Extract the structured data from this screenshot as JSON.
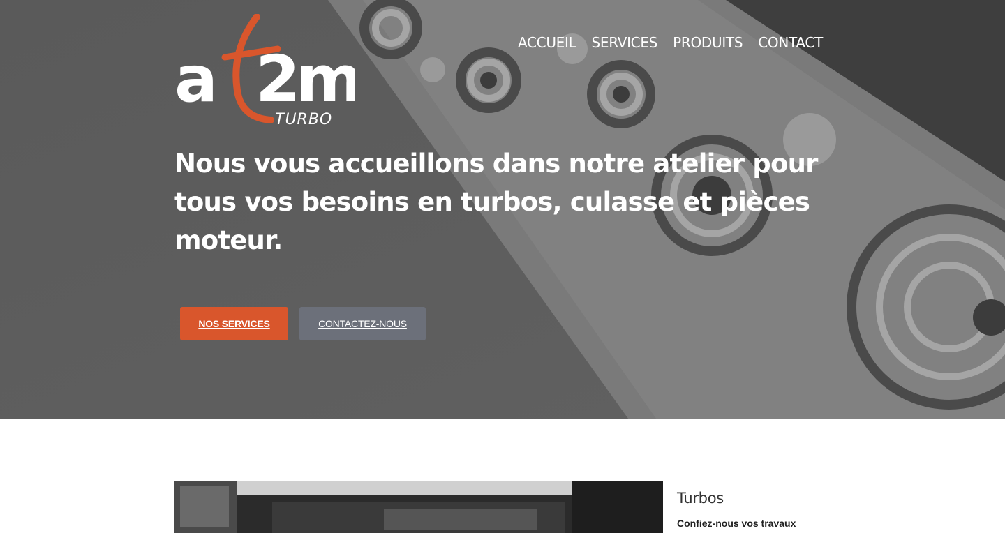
{
  "brand": {
    "logo_text": "at2m",
    "logo_sub": "TURBO",
    "accent": "#d9562c"
  },
  "nav": {
    "items": [
      {
        "label": "ACCUEIL"
      },
      {
        "label": "SERVICES"
      },
      {
        "label": "PRODUITS"
      },
      {
        "label": "CONTACT"
      }
    ]
  },
  "hero": {
    "headline_normal_1": "Nous vous accueillons dans notre atelier pour tous vos besoins en ",
    "headline_bold": "turbos, culasse et pièces moteur.",
    "primary_button": "NOS SERVICES",
    "secondary_button": "CONTACTEZ-NOUS"
  },
  "section": {
    "title": "Turbos",
    "subtitle": "Confiez-nous vos travaux"
  }
}
